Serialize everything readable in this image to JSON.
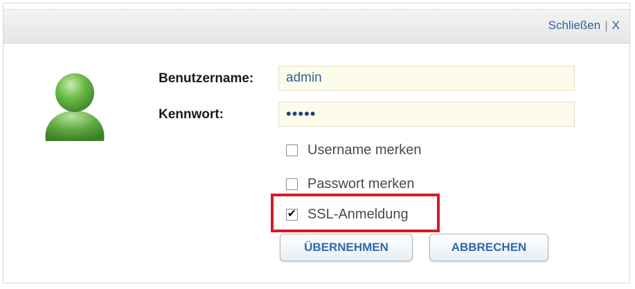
{
  "header": {
    "close_label": "Schließen",
    "separator": "|",
    "close_x": "X"
  },
  "form": {
    "username_label": "Benutzername:",
    "username_value": "admin",
    "password_label": "Kennwort:",
    "password_value": "•••••"
  },
  "options": [
    {
      "label": "Username merken",
      "checked": false
    },
    {
      "label": "Passwort merken",
      "checked": false
    },
    {
      "label": "SSL-Anmeldung",
      "checked": true
    }
  ],
  "buttons": {
    "apply_label": "ÜBERNEHMEN",
    "cancel_label": "ABBRECHEN"
  },
  "icons": {
    "avatar": "user-avatar-icon",
    "check": "✔"
  },
  "colors": {
    "link": "#2f5ea0",
    "highlight": "#d61a24",
    "avatar": "#5ea83f",
    "field_bg": "#fdfbea"
  }
}
